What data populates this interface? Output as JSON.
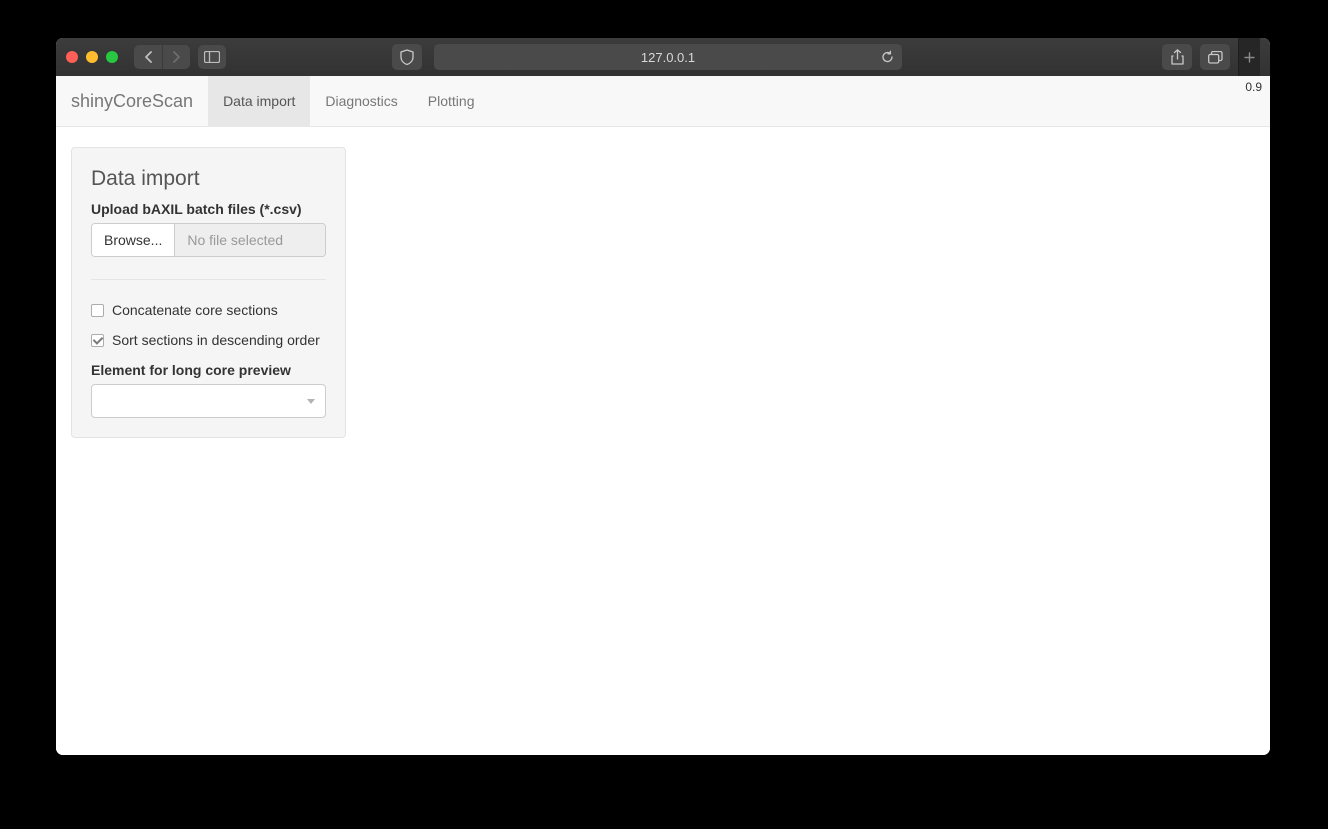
{
  "browser": {
    "address": "127.0.0.1"
  },
  "app": {
    "brand": "shinyCoreScan",
    "version": "0.9",
    "tabs": [
      "Data import",
      "Diagnostics",
      "Plotting"
    ],
    "active_tab": 0
  },
  "panel": {
    "title": "Data import",
    "upload_label": "Upload bAXIL batch files (*.csv)",
    "browse_label": "Browse...",
    "file_status": "No file selected",
    "checkbox_concatenate": {
      "label": "Concatenate core sections",
      "checked": false
    },
    "checkbox_sort": {
      "label": "Sort sections in descending order",
      "checked": true
    },
    "element_label": "Element for long core preview",
    "element_selected": ""
  }
}
